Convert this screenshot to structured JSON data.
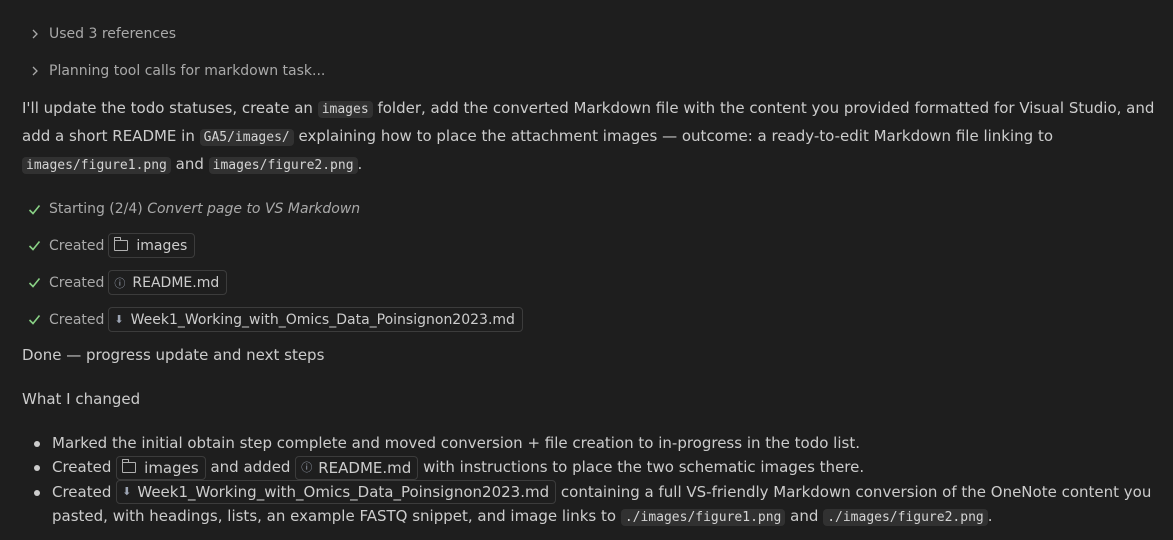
{
  "collapsibles": [
    {
      "label": "Used 3 references"
    },
    {
      "label": "Planning tool calls for markdown task..."
    }
  ],
  "intro": {
    "t1": "I'll update the todo statuses, create an ",
    "c1": "images",
    "t2": " folder, add the converted Markdown file with the content you provided formatted for Visual Studio, and add a short README in ",
    "c2": "GA5/images/",
    "t3": " explaining how to place the attachment images — outcome: a ready-to-edit Markdown file linking to ",
    "c3": "images/figure1.png",
    "t4": " and ",
    "c4": "images/figure2.png",
    "t5": "."
  },
  "progress": [
    {
      "prefix": "Starting (2/4)",
      "detail": "Convert page to VS Markdown"
    },
    {
      "prefix": "Created",
      "chip": "images",
      "icon": "folder-icon"
    },
    {
      "prefix": "Created",
      "chip": "README.md",
      "icon": "info-icon"
    },
    {
      "prefix": "Created",
      "chip": "Week1_Working_with_Omics_Data_Poinsignon2023.md",
      "icon": "markdown-icon"
    }
  ],
  "done_heading": "Done — progress update and next steps",
  "changed_heading": "What I changed",
  "bullets": {
    "b1": "Marked the initial obtain step complete and moved conversion + file creation to in-progress in the todo list.",
    "b2_pre": "Created",
    "b2_chip1": "images",
    "b2_mid": "and added",
    "b2_chip2": "README.md",
    "b2_post": "with instructions to place the two schematic images there.",
    "b3_pre": "Created",
    "b3_chip": "Week1_Working_with_Omics_Data_Poinsignon2023.md",
    "b3_post": "containing a full VS-friendly Markdown conversion of the OneNote content you pasted, with headings, lists, an example FASTQ snippet, and image links to",
    "b3_code1": "./images/figure1.png",
    "b3_and": "and",
    "b3_code2": "./images/figure2.png",
    "b3_end": "."
  }
}
